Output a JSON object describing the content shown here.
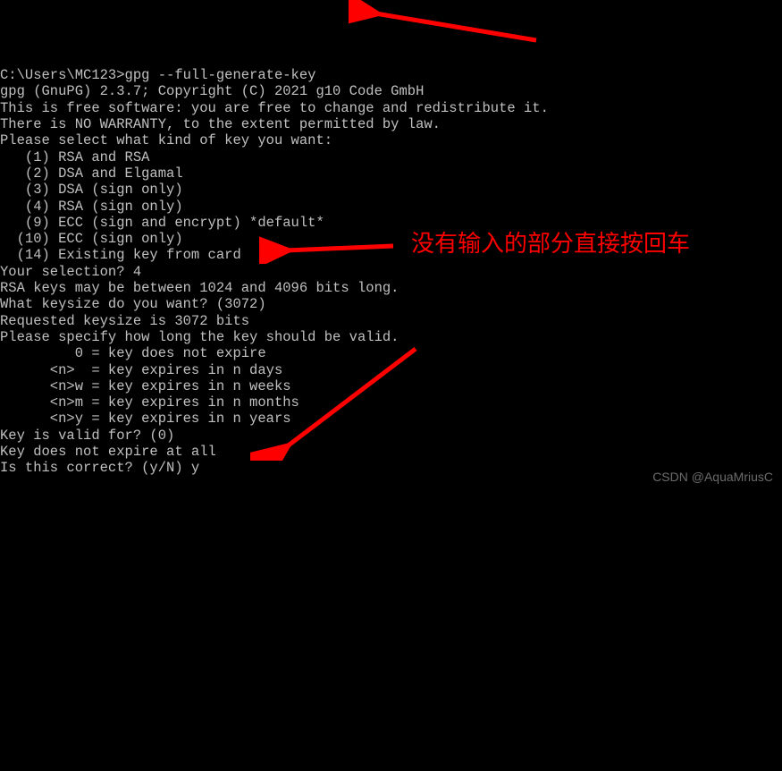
{
  "terminal": {
    "prompt_line": "C:\\Users\\MC123>gpg --full-generate-key",
    "lines": [
      "gpg (GnuPG) 2.3.7; Copyright (C) 2021 g10 Code GmbH",
      "This is free software: you are free to change and redistribute it.",
      "There is NO WARRANTY, to the extent permitted by law.",
      "",
      "Please select what kind of key you want:",
      "   (1) RSA and RSA",
      "   (2) DSA and Elgamal",
      "   (3) DSA (sign only)",
      "   (4) RSA (sign only)",
      "   (9) ECC (sign and encrypt) *default*",
      "  (10) ECC (sign only)",
      "  (14) Existing key from card",
      "Your selection? 4",
      "RSA keys may be between 1024 and 4096 bits long.",
      "What keysize do you want? (3072)",
      "Requested keysize is 3072 bits",
      "Please specify how long the key should be valid.",
      "         0 = key does not expire",
      "      <n>  = key expires in n days",
      "      <n>w = key expires in n weeks",
      "      <n>m = key expires in n months",
      "      <n>y = key expires in n years",
      "Key is valid for? (0)",
      "Key does not expire at all",
      "Is this correct? (y/N) y"
    ]
  },
  "annotations": {
    "text": "没有输入的部分直接按回车"
  },
  "watermark": "CSDN @AquaMriusC"
}
